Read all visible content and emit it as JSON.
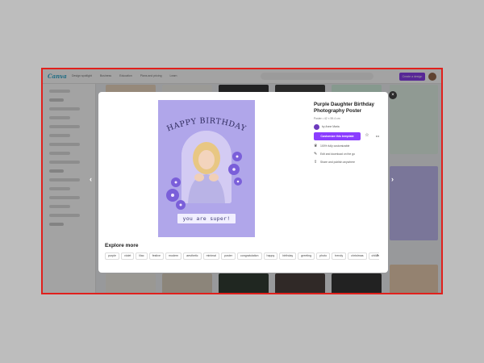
{
  "app": {
    "logo": "Canva",
    "top_nav": [
      "Design spotlight",
      "Business",
      "Education",
      "Plans and pricing",
      "Learn"
    ],
    "create_label": "Create a design"
  },
  "modal": {
    "title": "Purple Daughter Birthday Photography Poster",
    "size": "Poster • 42 × 59.4 cm",
    "author": "by Anne Maria",
    "customize_label": "Customize this template",
    "features": [
      {
        "icon": "crown-icon",
        "text": "100% fully customizable"
      },
      {
        "icon": "pencil-icon",
        "text": "Edit and download on the go"
      },
      {
        "icon": "share-icon",
        "text": "Share and publish anywhere"
      }
    ],
    "poster": {
      "headline": "HAPPY BIRTHDAY",
      "tag": "you are super!"
    },
    "explore_title": "Explore more",
    "chips": [
      "purple",
      "violet",
      "lilac",
      "festive",
      "modern",
      "aesthetic",
      "minimal",
      "poster",
      "congratulation",
      "happy",
      "birthday",
      "greeting",
      "photo",
      "trendy",
      "christmas",
      "children",
      "child"
    ],
    "close_glyph": "×",
    "prev_glyph": "‹",
    "next_glyph": "›",
    "more_glyph": "•••",
    "star_glyph": "☆",
    "chip_arrow": "›"
  },
  "colors": {
    "accent": "#8b3dff",
    "poster_bg": "#b0a6ea",
    "highlight_border": "#e0201c"
  }
}
